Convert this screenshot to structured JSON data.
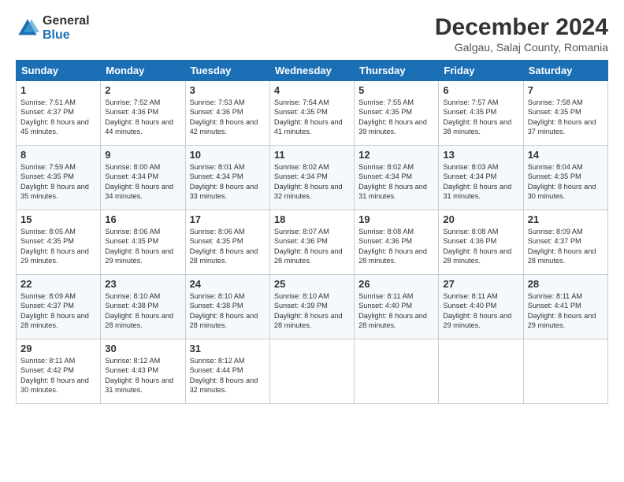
{
  "header": {
    "logo_general": "General",
    "logo_blue": "Blue",
    "month_title": "December 2024",
    "location": "Galgau, Salaj County, Romania"
  },
  "days_of_week": [
    "Sunday",
    "Monday",
    "Tuesday",
    "Wednesday",
    "Thursday",
    "Friday",
    "Saturday"
  ],
  "weeks": [
    [
      {
        "day": "1",
        "sunrise": "7:51 AM",
        "sunset": "4:37 PM",
        "daylight": "8 hours and 45 minutes."
      },
      {
        "day": "2",
        "sunrise": "7:52 AM",
        "sunset": "4:36 PM",
        "daylight": "8 hours and 44 minutes."
      },
      {
        "day": "3",
        "sunrise": "7:53 AM",
        "sunset": "4:36 PM",
        "daylight": "8 hours and 42 minutes."
      },
      {
        "day": "4",
        "sunrise": "7:54 AM",
        "sunset": "4:35 PM",
        "daylight": "8 hours and 41 minutes."
      },
      {
        "day": "5",
        "sunrise": "7:55 AM",
        "sunset": "4:35 PM",
        "daylight": "8 hours and 39 minutes."
      },
      {
        "day": "6",
        "sunrise": "7:57 AM",
        "sunset": "4:35 PM",
        "daylight": "8 hours and 38 minutes."
      },
      {
        "day": "7",
        "sunrise": "7:58 AM",
        "sunset": "4:35 PM",
        "daylight": "8 hours and 37 minutes."
      }
    ],
    [
      {
        "day": "8",
        "sunrise": "7:59 AM",
        "sunset": "4:35 PM",
        "daylight": "8 hours and 35 minutes."
      },
      {
        "day": "9",
        "sunrise": "8:00 AM",
        "sunset": "4:34 PM",
        "daylight": "8 hours and 34 minutes."
      },
      {
        "day": "10",
        "sunrise": "8:01 AM",
        "sunset": "4:34 PM",
        "daylight": "8 hours and 33 minutes."
      },
      {
        "day": "11",
        "sunrise": "8:02 AM",
        "sunset": "4:34 PM",
        "daylight": "8 hours and 32 minutes."
      },
      {
        "day": "12",
        "sunrise": "8:02 AM",
        "sunset": "4:34 PM",
        "daylight": "8 hours and 31 minutes."
      },
      {
        "day": "13",
        "sunrise": "8:03 AM",
        "sunset": "4:34 PM",
        "daylight": "8 hours and 31 minutes."
      },
      {
        "day": "14",
        "sunrise": "8:04 AM",
        "sunset": "4:35 PM",
        "daylight": "8 hours and 30 minutes."
      }
    ],
    [
      {
        "day": "15",
        "sunrise": "8:05 AM",
        "sunset": "4:35 PM",
        "daylight": "8 hours and 29 minutes."
      },
      {
        "day": "16",
        "sunrise": "8:06 AM",
        "sunset": "4:35 PM",
        "daylight": "8 hours and 29 minutes."
      },
      {
        "day": "17",
        "sunrise": "8:06 AM",
        "sunset": "4:35 PM",
        "daylight": "8 hours and 28 minutes."
      },
      {
        "day": "18",
        "sunrise": "8:07 AM",
        "sunset": "4:36 PM",
        "daylight": "8 hours and 28 minutes."
      },
      {
        "day": "19",
        "sunrise": "8:08 AM",
        "sunset": "4:36 PM",
        "daylight": "8 hours and 28 minutes."
      },
      {
        "day": "20",
        "sunrise": "8:08 AM",
        "sunset": "4:36 PM",
        "daylight": "8 hours and 28 minutes."
      },
      {
        "day": "21",
        "sunrise": "8:09 AM",
        "sunset": "4:37 PM",
        "daylight": "8 hours and 28 minutes."
      }
    ],
    [
      {
        "day": "22",
        "sunrise": "8:09 AM",
        "sunset": "4:37 PM",
        "daylight": "8 hours and 28 minutes."
      },
      {
        "day": "23",
        "sunrise": "8:10 AM",
        "sunset": "4:38 PM",
        "daylight": "8 hours and 28 minutes."
      },
      {
        "day": "24",
        "sunrise": "8:10 AM",
        "sunset": "4:38 PM",
        "daylight": "8 hours and 28 minutes."
      },
      {
        "day": "25",
        "sunrise": "8:10 AM",
        "sunset": "4:39 PM",
        "daylight": "8 hours and 28 minutes."
      },
      {
        "day": "26",
        "sunrise": "8:11 AM",
        "sunset": "4:40 PM",
        "daylight": "8 hours and 28 minutes."
      },
      {
        "day": "27",
        "sunrise": "8:11 AM",
        "sunset": "4:40 PM",
        "daylight": "8 hours and 29 minutes."
      },
      {
        "day": "28",
        "sunrise": "8:11 AM",
        "sunset": "4:41 PM",
        "daylight": "8 hours and 29 minutes."
      }
    ],
    [
      {
        "day": "29",
        "sunrise": "8:11 AM",
        "sunset": "4:42 PM",
        "daylight": "8 hours and 30 minutes."
      },
      {
        "day": "30",
        "sunrise": "8:12 AM",
        "sunset": "4:43 PM",
        "daylight": "8 hours and 31 minutes."
      },
      {
        "day": "31",
        "sunrise": "8:12 AM",
        "sunset": "4:44 PM",
        "daylight": "8 hours and 32 minutes."
      },
      null,
      null,
      null,
      null
    ]
  ]
}
